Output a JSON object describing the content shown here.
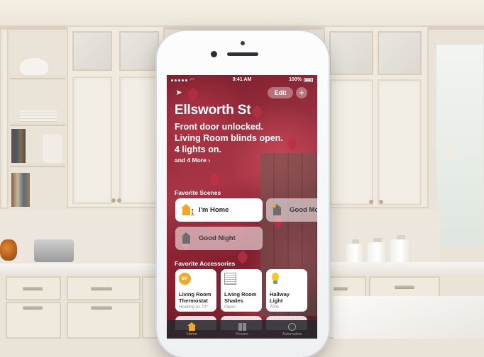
{
  "status_bar": {
    "time": "9:41 AM",
    "battery": "100%"
  },
  "toolbar": {
    "edit_label": "Edit",
    "add_label": "+"
  },
  "home": {
    "title": "Ellsworth St",
    "summary_lines": [
      "Front door unlocked.",
      "Living Room blinds open.",
      "4 lights on."
    ],
    "more_label": "and 4 More ›"
  },
  "favorite_scenes": {
    "heading": "Favorite Scenes",
    "items": [
      {
        "label": "I'm Home",
        "icon": "house-person-icon"
      },
      {
        "label": "Good Mo",
        "icon": "house-sun-icon"
      },
      {
        "label": "Good Night",
        "icon": "house-moon-icon"
      }
    ]
  },
  "favorite_accessories": {
    "heading": "Favorite Accessories",
    "items": [
      {
        "name_line1": "Living Room",
        "name_line2": "Thermostat",
        "status": "Heating to 72°",
        "icon_text": "68°",
        "icon": "thermostat-icon"
      },
      {
        "name_line1": "Living Room",
        "name_line2": "Shades",
        "status": "Open",
        "icon": "shades-icon"
      },
      {
        "name_line1": "Hallway",
        "name_line2": "Light",
        "status": "70%",
        "icon": "lightbulb-icon"
      }
    ]
  },
  "tabs": [
    {
      "label": "Home",
      "active": true
    },
    {
      "label": "Rooms",
      "active": false
    },
    {
      "label": "Automation",
      "active": false
    }
  ],
  "colors": {
    "accent": "#f5a623",
    "tab_bar": "#28282d",
    "card": "#ffffff"
  }
}
